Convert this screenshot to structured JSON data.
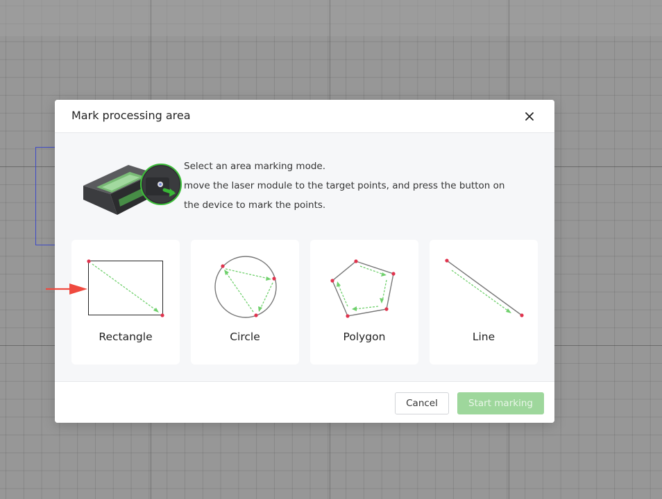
{
  "dialog": {
    "title": "Mark processing area",
    "close_icon": "close-icon"
  },
  "intro": {
    "device_icon": "laser-module-icon",
    "lines": [
      "Select an area marking mode.",
      "move the laser module to the target points, and press the button on",
      "the device to mark the points."
    ]
  },
  "modes": [
    {
      "label": "Rectangle",
      "icon": "rectangle-icon"
    },
    {
      "label": "Circle",
      "icon": "circle-icon"
    },
    {
      "label": "Polygon",
      "icon": "polygon-icon"
    },
    {
      "label": "Line",
      "icon": "line-icon"
    }
  ],
  "footer": {
    "cancel_label": "Cancel",
    "start_label": "Start marking"
  },
  "colors": {
    "accent_green": "#4cc14a",
    "disabled_green": "#9ed79c",
    "point_red": "#e0334d",
    "arrow_red": "#ef4a3f"
  }
}
